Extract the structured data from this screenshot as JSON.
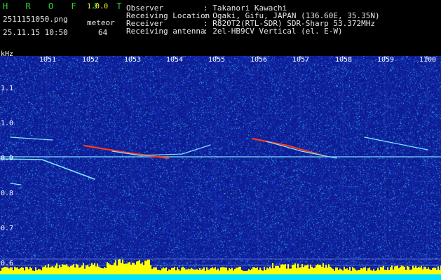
{
  "app": {
    "title": "H R O F F T",
    "version": "1.0.0",
    "filename": "2511151050.png",
    "timestamp": "25.11.15 10:50",
    "mode_label": "meteor",
    "count": "64"
  },
  "observer_info": [
    {
      "label": "Observer",
      "value": ": Takanori Kawachi"
    },
    {
      "label": "Receiving Location",
      "value": ": Ogaki, Gifu, JAPAN (136.60E, 35.35N)"
    },
    {
      "label": "Receiver",
      "value": ": R820T2(RTL-SDR) SDR-Sharp 53.372MHz"
    },
    {
      "label": "Receiving antenna",
      "value": ": 2el-HB9CV Vertical (el. E-W)"
    }
  ],
  "plot": {
    "y_unit": "kHz",
    "y_ticks": [
      "1.1",
      "1.0",
      "0.9",
      "0.8",
      "0.7",
      "0.6"
    ],
    "x_ticks": [
      "1051",
      "1052",
      "1053",
      "1054",
      "1055",
      "1056",
      "1057",
      "1058",
      "1059",
      "1100"
    ],
    "colors": {
      "background": "#0f1f9a",
      "signal": "#ff3a1e",
      "carrier": "#7fe8ff",
      "bar": "#ffff00",
      "base": "#00e5ff"
    }
  }
}
